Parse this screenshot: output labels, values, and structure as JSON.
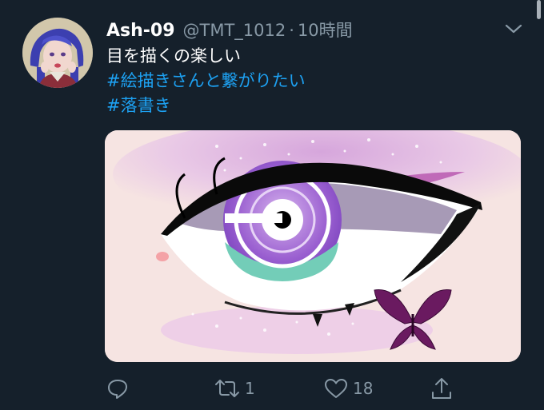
{
  "tweet": {
    "display_name": "Ash-09",
    "handle": "@TMT_1012",
    "separator": "·",
    "timestamp": "10時間",
    "text_line1": "目を描くの楽しい",
    "hashtag1": "#絵描きさんと繋がりたい",
    "hashtag2": "#落書き"
  },
  "actions": {
    "reply_count": "",
    "retweet_count": "1",
    "like_count": "18"
  },
  "icons": {
    "menu": "chevron-down-icon",
    "reply": "reply-icon",
    "retweet": "retweet-icon",
    "like": "heart-icon",
    "share": "share-icon"
  },
  "colors": {
    "background": "#15202b",
    "secondary_text": "#8899a6",
    "hashtag": "#1da1f2"
  }
}
